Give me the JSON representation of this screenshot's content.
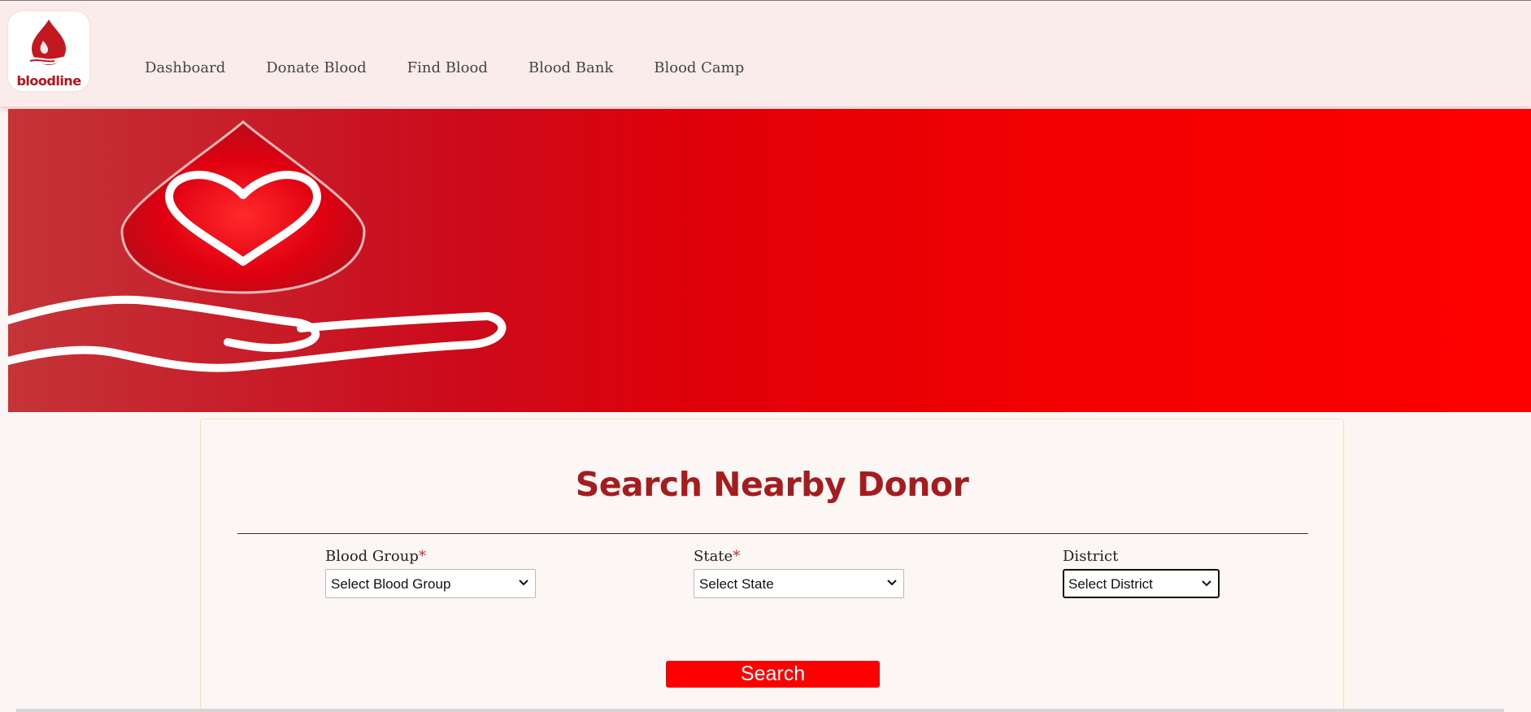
{
  "brand": {
    "name": "bloodline",
    "logo_icon": "blood-drop-hand-icon"
  },
  "nav": {
    "items": [
      {
        "label": "Dashboard"
      },
      {
        "label": "Donate Blood"
      },
      {
        "label": "Find Blood"
      },
      {
        "label": "Blood Bank"
      },
      {
        "label": "Blood Camp"
      }
    ]
  },
  "banner": {
    "icons": [
      "heart-drop-icon",
      "open-hand-icon"
    ]
  },
  "search": {
    "title": "Search Nearby Donor",
    "required_mark": "*",
    "blood_group": {
      "label": "Blood Group",
      "value": "Select Blood Group"
    },
    "state": {
      "label": "State",
      "value": "Select State"
    },
    "district": {
      "label": "District",
      "value": "Select District"
    },
    "button_label": "Search"
  },
  "colors": {
    "brand_red": "#ff0000",
    "title_red": "#a51c1f",
    "header_bg": "#f9eceb",
    "page_bg": "#fbf5f4"
  }
}
